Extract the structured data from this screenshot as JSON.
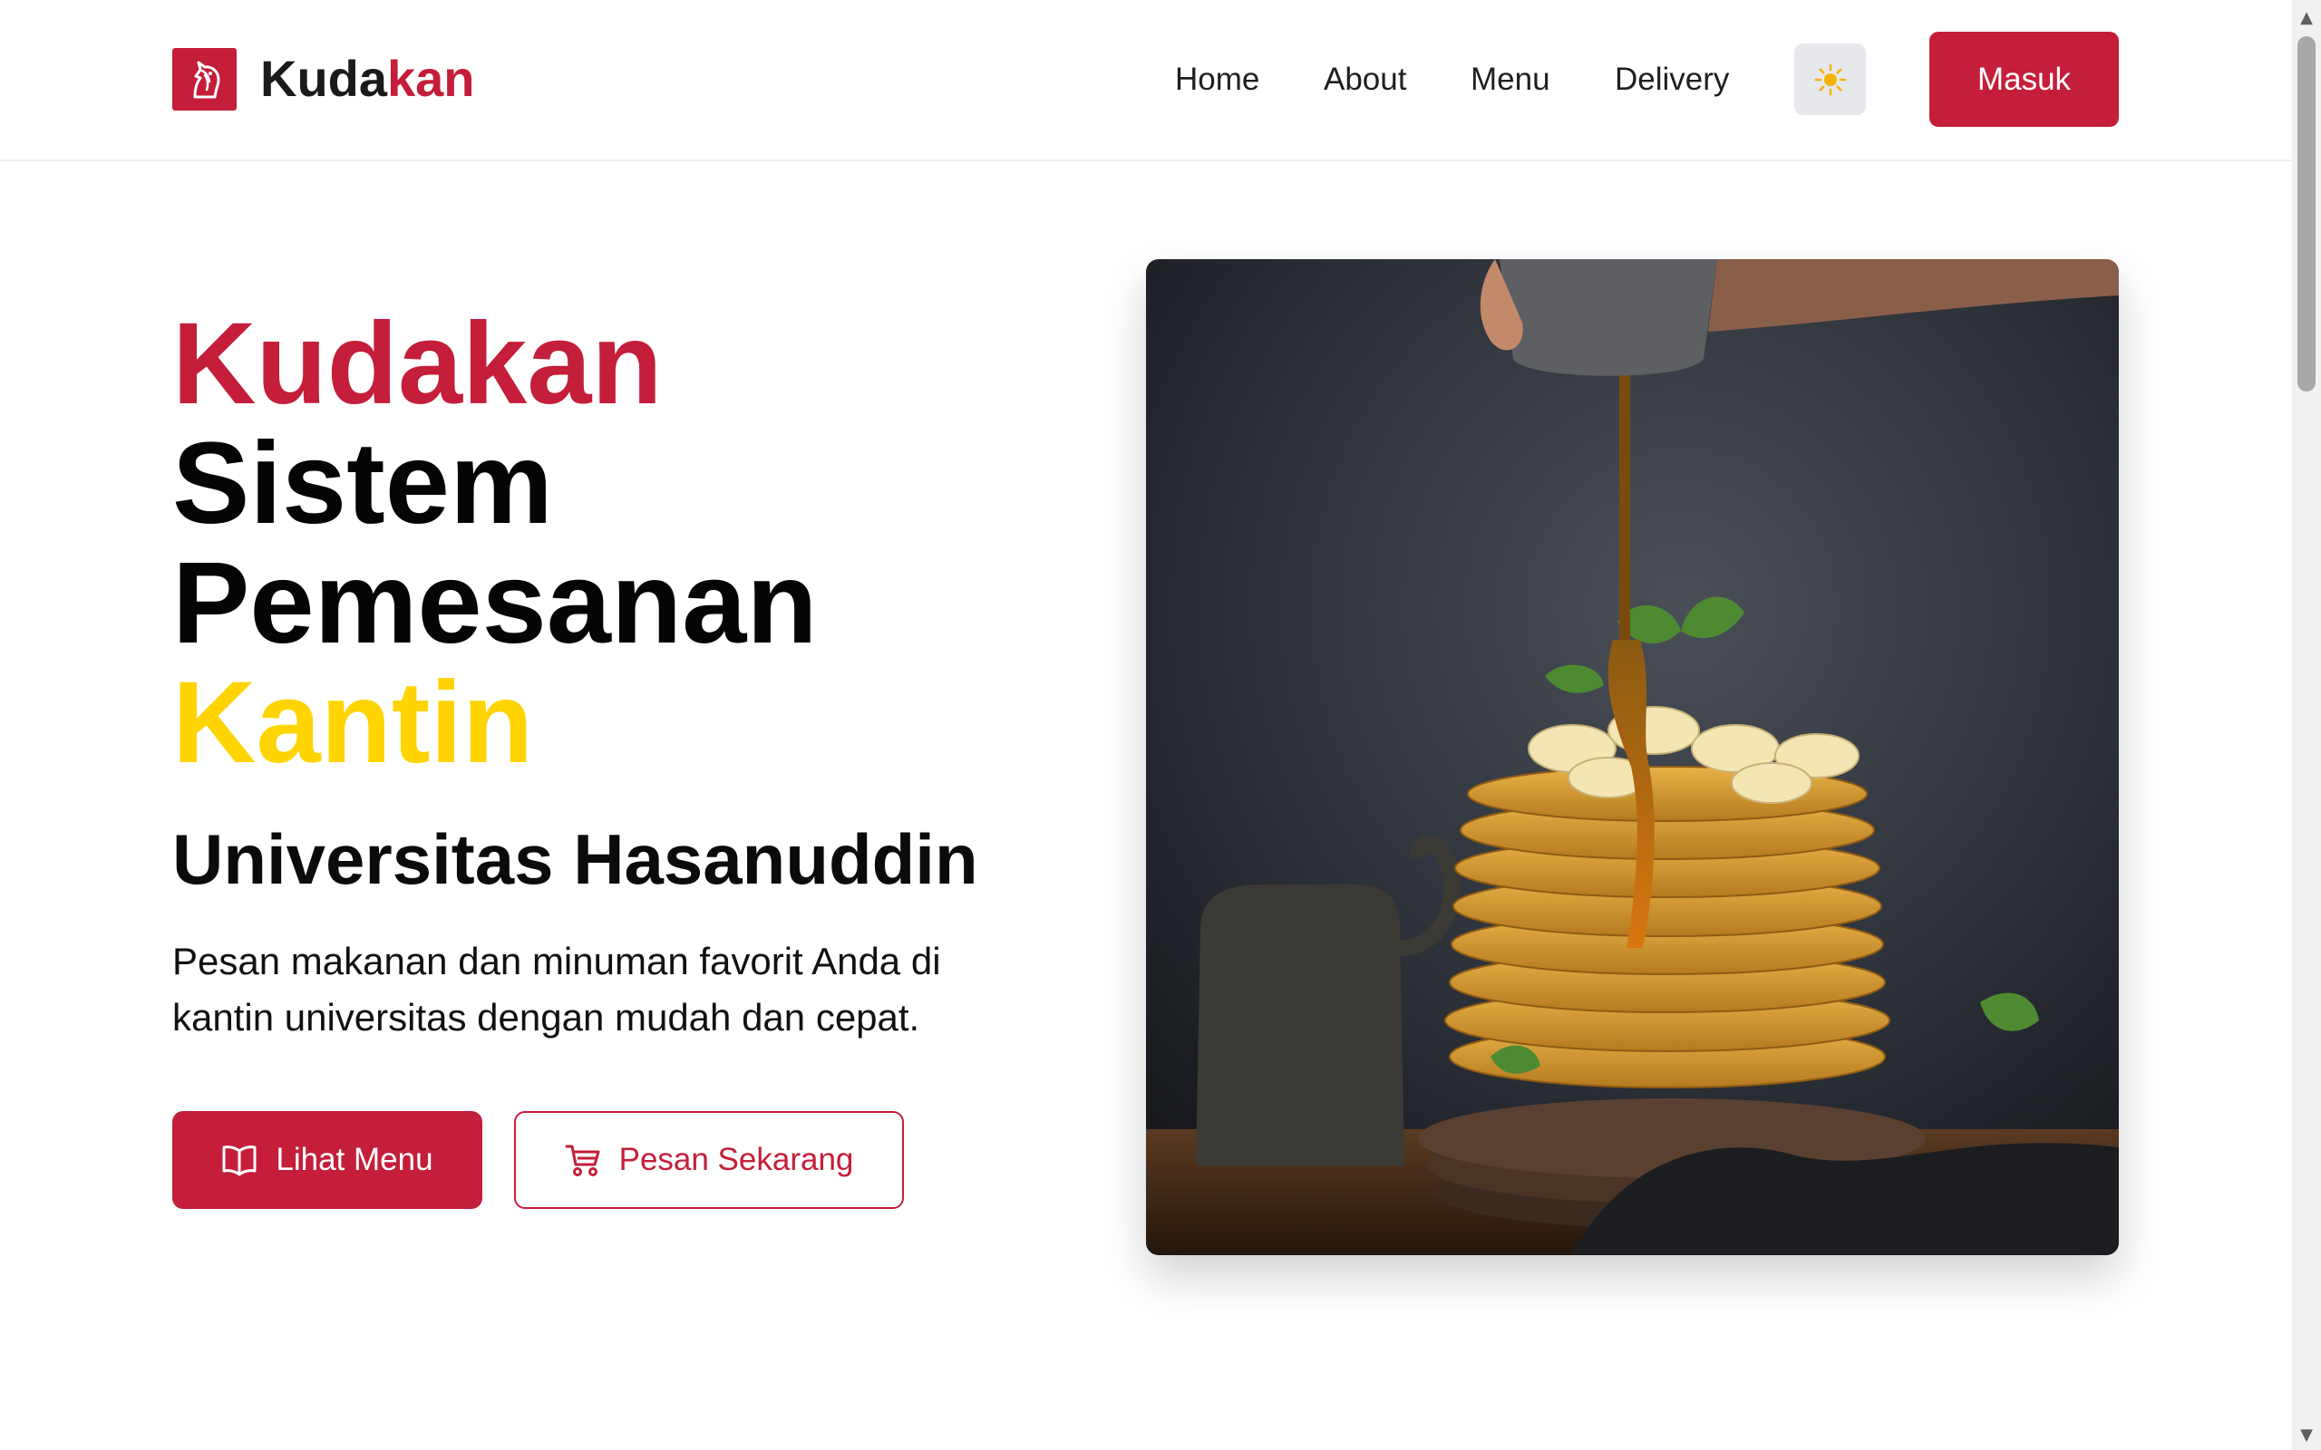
{
  "brand": {
    "name_part1": "Kuda",
    "name_part2": "kan",
    "logo_icon": "horse-head-icon",
    "accent_color": "#c41e3a",
    "highlight_color": "#ffd400"
  },
  "nav": {
    "items": [
      {
        "label": "Home"
      },
      {
        "label": "About"
      },
      {
        "label": "Menu"
      },
      {
        "label": "Delivery"
      }
    ],
    "theme_toggle_icon": "sun-icon",
    "login_label": "Masuk"
  },
  "hero": {
    "title_line1": "Kudakan",
    "title_line2": "Sistem",
    "title_line3": "Pemesanan",
    "title_line4": "Kantin",
    "subtitle": "Universitas Hasanuddin",
    "description": "Pesan makanan dan minuman favorit Anda di kantin universitas dengan mudah dan cepat.",
    "primary_button": {
      "label": "Lihat Menu",
      "icon": "book-icon"
    },
    "secondary_button": {
      "label": "Pesan Sekarang",
      "icon": "cart-icon"
    },
    "image_subject": "pancake-stack-with-syrup"
  }
}
